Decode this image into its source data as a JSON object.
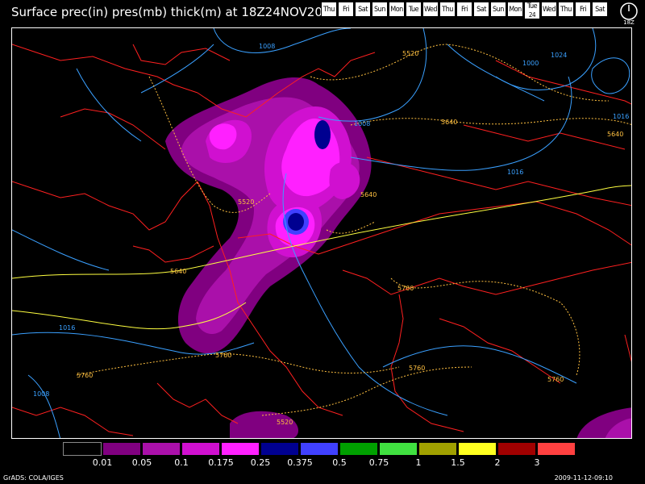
{
  "header": {
    "title": "Surface prec(in) pres(mb) thick(m) at 18Z24NOV2009"
  },
  "day_strip": {
    "days": [
      "Thu",
      "Fri",
      "Sat",
      "Sun",
      "Mon",
      "Tue",
      "Wed",
      "Thu",
      "Fri",
      "Sat",
      "Sun",
      "Mon",
      "Tue",
      "Wed",
      "Thu",
      "Fri",
      "Sat"
    ],
    "current_index": 12,
    "current_sub": "24"
  },
  "clock": {
    "label": "18Z"
  },
  "map": {
    "pressure_labels": [
      "1008",
      "1008",
      "1016",
      "1024",
      "1000",
      "1016",
      "1016",
      "1008"
    ],
    "thickness_labels": [
      "5520",
      "5520",
      "5640",
      "5640",
      "5640",
      "5640",
      "5760",
      "5760",
      "5760",
      "5760",
      "5760",
      "5520"
    ]
  },
  "legend": {
    "colors": [
      "#000000",
      "#800080",
      "#aa10aa",
      "#d010d0",
      "#ff20ff",
      "#000090",
      "#4040ff",
      "#00a000",
      "#40e040",
      "#a0a000",
      "#ffff20",
      "#a00000",
      "#ff4040"
    ],
    "labels": [
      "0.01",
      "0.05",
      "0.1",
      "0.175",
      "0.25",
      "0.375",
      "0.5",
      "0.75",
      "1",
      "1.5",
      "2",
      "3"
    ]
  },
  "footer": {
    "left": "GrADS: COLA/IGES",
    "right": "2009-11-12-09:10"
  }
}
